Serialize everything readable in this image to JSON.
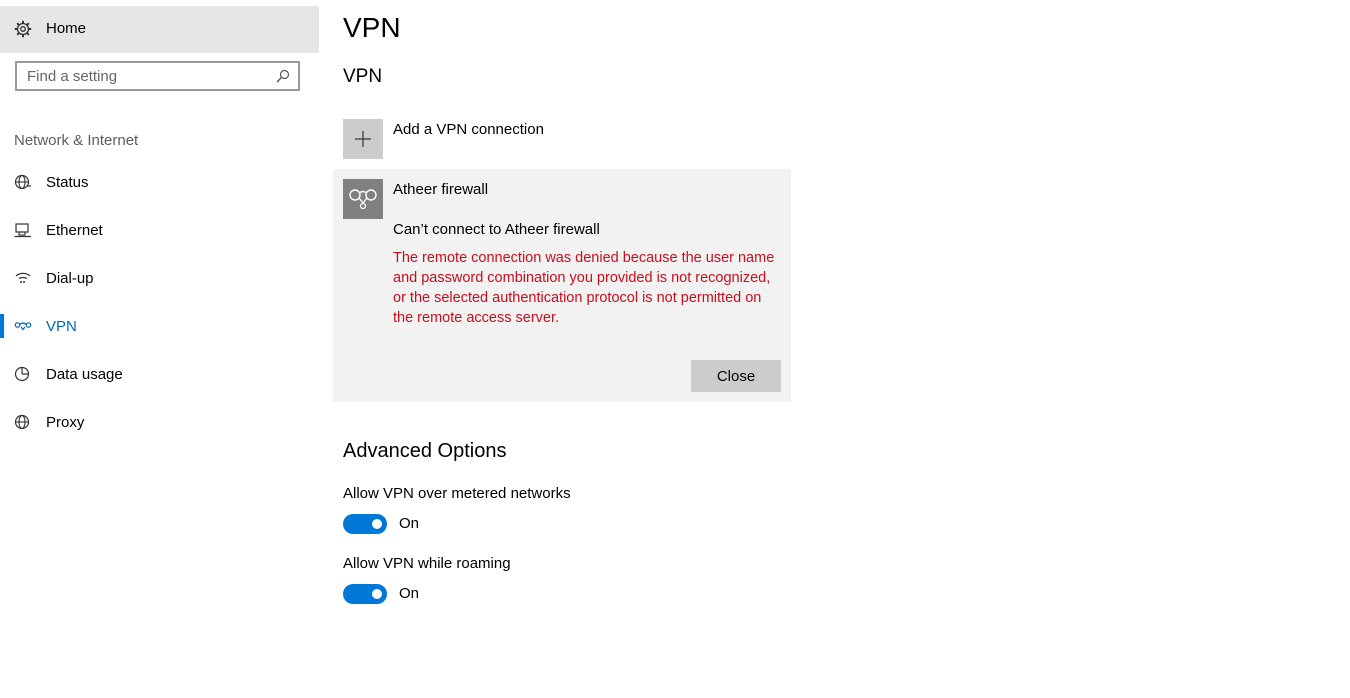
{
  "sidebar": {
    "home_label": "Home",
    "search_placeholder": "Find a setting",
    "section_title": "Network & Internet",
    "items": [
      {
        "label": "Status",
        "icon": "status-globe-icon"
      },
      {
        "label": "Ethernet",
        "icon": "ethernet-icon"
      },
      {
        "label": "Dial-up",
        "icon": "dial-up-icon"
      },
      {
        "label": "VPN",
        "icon": "vpn-icon",
        "active": true
      },
      {
        "label": "Data usage",
        "icon": "data-usage-icon"
      },
      {
        "label": "Proxy",
        "icon": "globe-icon"
      }
    ]
  },
  "main": {
    "page_title": "VPN",
    "section_title": "VPN",
    "add_vpn_label": "Add a VPN connection",
    "connection": {
      "name": "Atheer firewall",
      "status": "Can’t connect to Atheer firewall",
      "error": "The remote connection was denied because the user name and password combination you provided is not recognized, or the selected authentication protocol is not permitted on the remote access server.",
      "close_label": "Close"
    },
    "advanced": {
      "title": "Advanced Options",
      "options": [
        {
          "label": "Allow VPN over metered networks",
          "state": "On"
        },
        {
          "label": "Allow VPN while roaming",
          "state": "On"
        }
      ]
    }
  },
  "colors": {
    "accent": "#0078d7",
    "error": "#c50f1f",
    "card_bg": "#f2f2f2",
    "home_bg": "#e6e6e6"
  }
}
